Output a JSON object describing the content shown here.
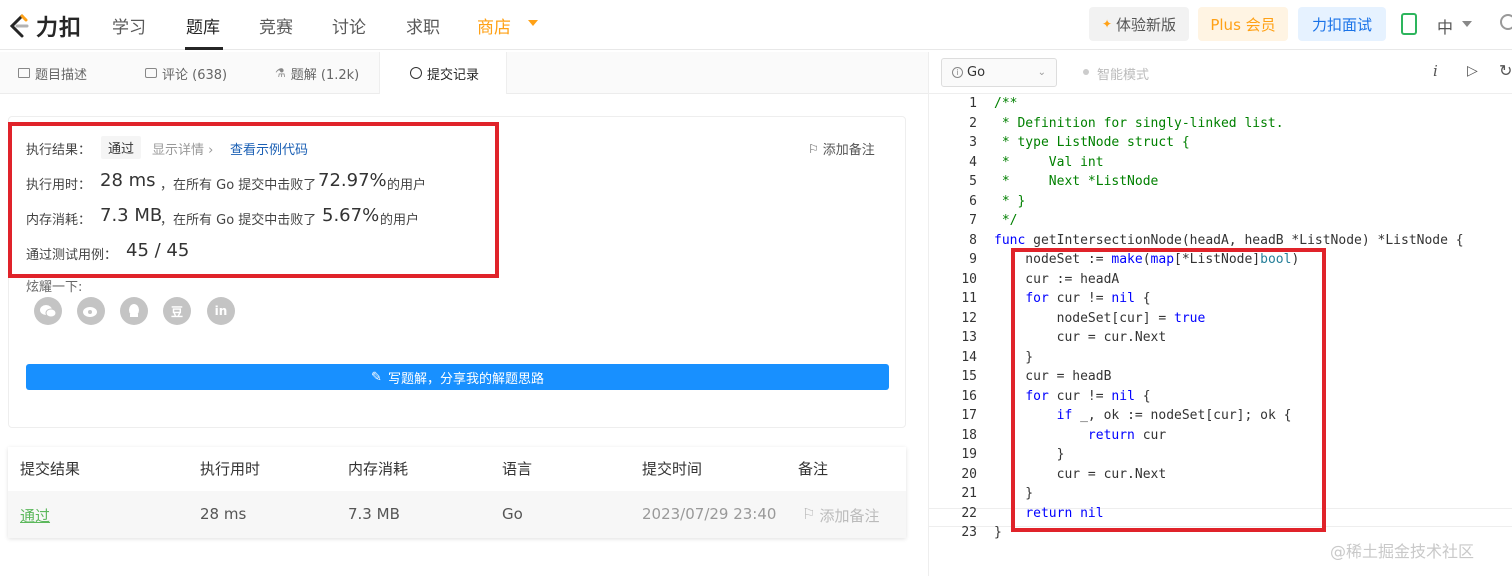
{
  "nav": {
    "logo_text": "力扣",
    "items": [
      "学习",
      "题库",
      "竞赛",
      "讨论",
      "求职"
    ],
    "shop": "商店",
    "new_version": "体验新版",
    "plus": "Plus 会员",
    "interview": "力扣面试",
    "language": "中"
  },
  "tabs": {
    "description": "题目描述",
    "comments": "评论 (638)",
    "solutions": "题解 (1.2k)",
    "submissions": "提交记录"
  },
  "result": {
    "exec_label": "执行结果：",
    "status": "通过",
    "show_detail": "显示详情 ›",
    "view_sample": "查看示例代码",
    "add_note": "添加备注",
    "time_label": "执行用时：",
    "time_value": "28 ms",
    "time_mid": "，在所有 Go 提交中击败了",
    "time_pct": "72.97%",
    "time_tail": "的用户",
    "mem_label": "内存消耗：",
    "mem_value": "7.3 MB",
    "mem_mid": "，在所有 Go 提交中击败了",
    "mem_pct": "5.67%",
    "mem_tail": "的用户",
    "cases_label": "通过测试用例：",
    "cases_value": "45 / 45",
    "share_label": "炫耀一下:",
    "share_icons": [
      "wechat-icon",
      "weibo-icon",
      "qq-icon",
      "douban-icon",
      "linkedin-icon"
    ],
    "douban_glyph": "豆",
    "linkedin_glyph": "in",
    "write_btn": "写题解，分享我的解题思路"
  },
  "table": {
    "headers": [
      "提交结果",
      "执行用时",
      "内存消耗",
      "语言",
      "提交时间",
      "备注"
    ],
    "row": {
      "status": "通过",
      "time": "28 ms",
      "memory": "7.3 MB",
      "lang": "Go",
      "submitted": "2023/07/29 23:40",
      "note": "添加备注"
    }
  },
  "editor": {
    "language": "Go",
    "smart_mode": "智能模式",
    "lines": [
      "/**",
      " * Definition for singly-linked list.",
      " * type ListNode struct {",
      " *     Val int",
      " *     Next *ListNode",
      " * }",
      " */",
      "func getIntersectionNode(headA, headB *ListNode) *ListNode {",
      "    nodeSet := make(map[*ListNode]bool)",
      "    cur := headA",
      "    for cur != nil {",
      "        nodeSet[cur] = true",
      "        cur = cur.Next",
      "    }",
      "    cur = headB",
      "    for cur != nil {",
      "        if _, ok := nodeSet[cur]; ok {",
      "            return cur",
      "        }",
      "        cur = cur.Next",
      "    }",
      "    return nil",
      "}"
    ]
  },
  "watermark": "@稀土掘金技术社区",
  "colors": {
    "accent": "#1890ff",
    "success": "#5cb85c",
    "shop": "#ffa116",
    "highlight": "#e0232a"
  }
}
